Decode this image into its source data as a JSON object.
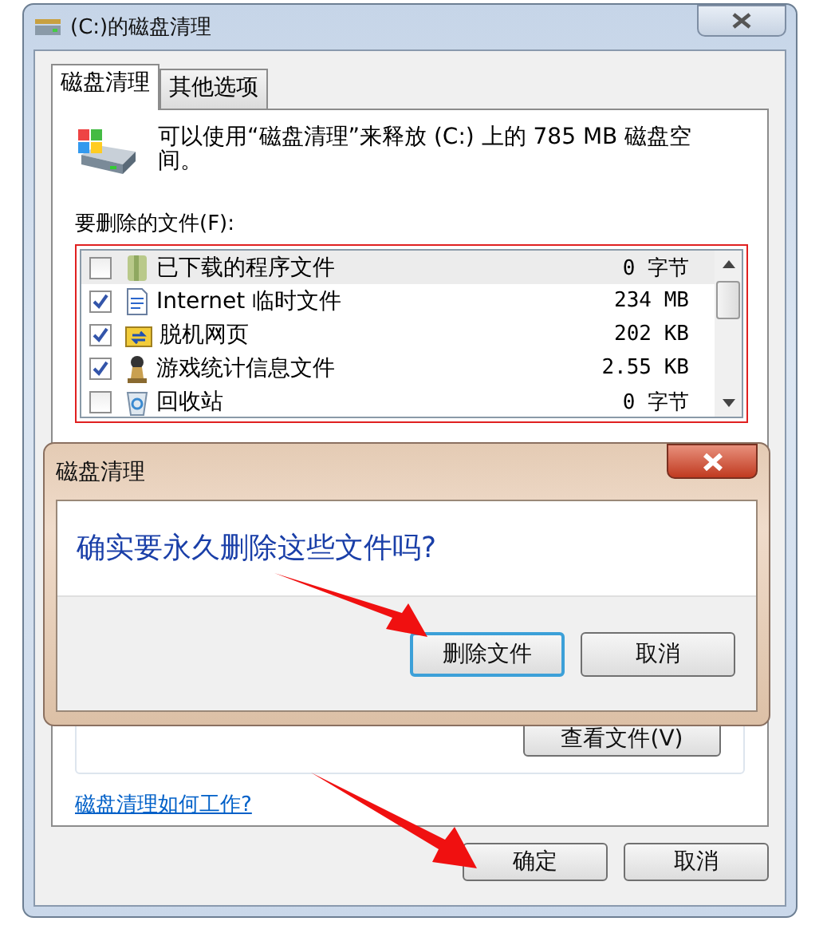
{
  "window": {
    "title": "(C:)的磁盘清理"
  },
  "tabs": [
    {
      "label": "磁盘清理",
      "selected": true
    },
    {
      "label": "其他选项",
      "selected": false
    }
  ],
  "description": "可以使用“磁盘清理”来释放 (C:) 上的 785 MB 磁盘空间。",
  "files_label": "要删除的文件(F):",
  "files": [
    {
      "kind": "program",
      "name": "已下载的程序文件",
      "size": "0 字节",
      "checked": false,
      "selected": true
    },
    {
      "kind": "internet",
      "name": "Internet 临时文件",
      "size": "234 MB",
      "checked": true,
      "selected": false
    },
    {
      "kind": "offline",
      "name": "脱机网页",
      "size": "202 KB",
      "checked": true,
      "selected": false
    },
    {
      "kind": "games",
      "name": "游戏统计信息文件",
      "size": "2.55 KB",
      "checked": true,
      "selected": false
    },
    {
      "kind": "recycle",
      "name": "回收站",
      "size": "0 字节",
      "checked": false,
      "selected": false
    }
  ],
  "view_files_button": "查看文件(V)",
  "help_link": "磁盘清理如何工作?",
  "buttons": [
    "确定",
    "取消"
  ],
  "dialog": {
    "title": "磁盘清理",
    "message": "确实要永久删除这些文件吗?",
    "buttons": [
      {
        "label": "删除文件",
        "default": true
      },
      {
        "label": "取消",
        "default": false
      }
    ]
  }
}
